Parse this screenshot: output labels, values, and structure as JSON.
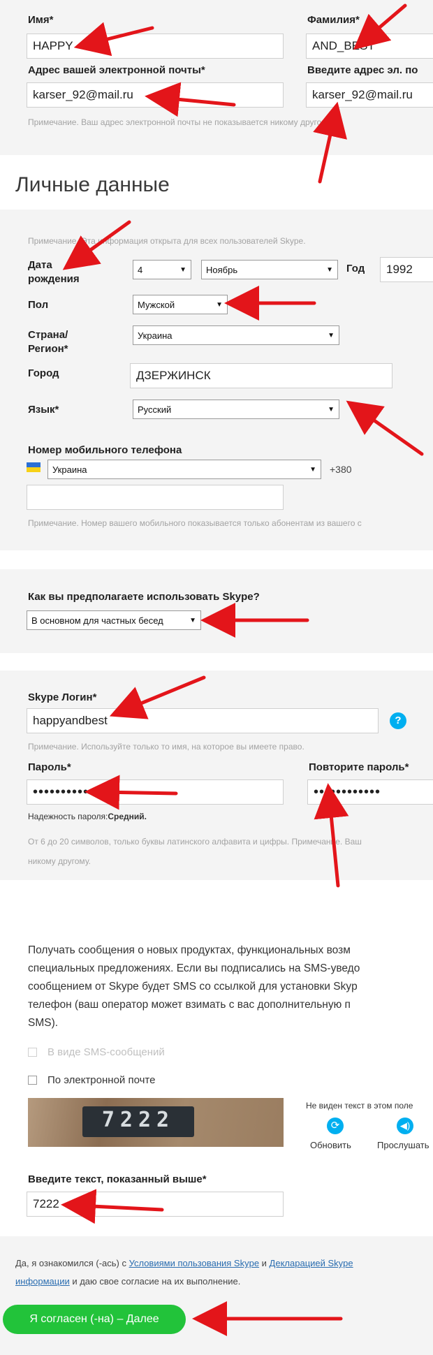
{
  "top": {
    "first_name_label": "Имя*",
    "first_name_value": "HAPPY",
    "last_name_label": "Фамилия*",
    "last_name_value": "AND_BEST",
    "email_label": "Адрес вашей электронной почты*",
    "email_value": "karser_92@mail.ru",
    "email_repeat_label": "Введите адрес эл. по",
    "email_repeat_value": "karser_92@mail.ru",
    "email_note": "Примечание. Ваш адрес электронной почты не показывается никому другому."
  },
  "personal": {
    "heading": "Личные данные",
    "note": "Примечание. Эта информация открыта для всех пользователей Skype.",
    "dob_label": "Дата рождения",
    "dob_day": "4",
    "dob_month": "Ноябрь",
    "year_label": "Год",
    "dob_year": "1992",
    "gender_label": "Пол",
    "gender_value": "Мужской",
    "country_label": "Страна/ Регион*",
    "country_value": "Украина",
    "city_label": "Город",
    "city_value": "ДЗЕРЖИНСК",
    "language_label": "Язык*",
    "language_value": "Русский",
    "phone_label": "Номер мобильного телефона",
    "phone_country": "Украина",
    "phone_code": "+380",
    "phone_value": "",
    "phone_note": "Примечание. Номер вашего мобильного показывается только абонентам из вашего с"
  },
  "usage": {
    "question": "Как вы предполагаете использовать Skype?",
    "value": "В основном для частных бесед"
  },
  "account": {
    "login_label": "Skype Логин*",
    "login_value": "happyandbest",
    "help_icon": "?",
    "login_note": "Примечание. Используйте только то имя, на которое вы имеете право.",
    "password_label": "Пароль*",
    "password_value": "••••••••••••",
    "password_repeat_label": "Повторите пароль*",
    "password_repeat_value": "••••••••••••",
    "strength_label": "Надежность пароля:",
    "strength_value": "Средний.",
    "rules_note_1": "От 6 до 20 символов, только буквы латинского алфавита и цифры. Примечание. Ваш",
    "rules_note_2": "никому другому."
  },
  "subscribe": {
    "text_line1": "Получать сообщения о новых продуктах, функциональных возм",
    "text_line2": "специальных предложениях. Если вы подписались на SMS-уведо",
    "text_line3": "сообщением от Skype будет SMS со ссылкой для установки Skyp",
    "text_line4": "телефон (ваш оператор может взимать с вас дополнительную п",
    "text_line5": "SMS).",
    "sms_option": "В виде SMS-сообщений",
    "email_option": "По электронной почте"
  },
  "captcha": {
    "image_text": "7222",
    "not_visible_text": "Не виден текст в этом поле",
    "refresh_label": "Обновить",
    "listen_label": "Прослушать",
    "input_label": "Введите текст, показанный выше*",
    "input_value": "7222"
  },
  "terms": {
    "prefix": "Да, я ознакомился (-ась) с ",
    "link1": "Условиями пользования Skype",
    "middle": " и ",
    "link2_part1": "Декларацией Skype",
    "link2_part2": "информации",
    "suffix": " и даю свое согласие на их выполнение."
  },
  "submit": {
    "label": "Я согласен (-на) – Далее"
  },
  "colors": {
    "arrow": "#e3151a",
    "submit_green": "#22c33a",
    "help_blue": "#00aff0",
    "section_bg": "#f4f4f4"
  }
}
